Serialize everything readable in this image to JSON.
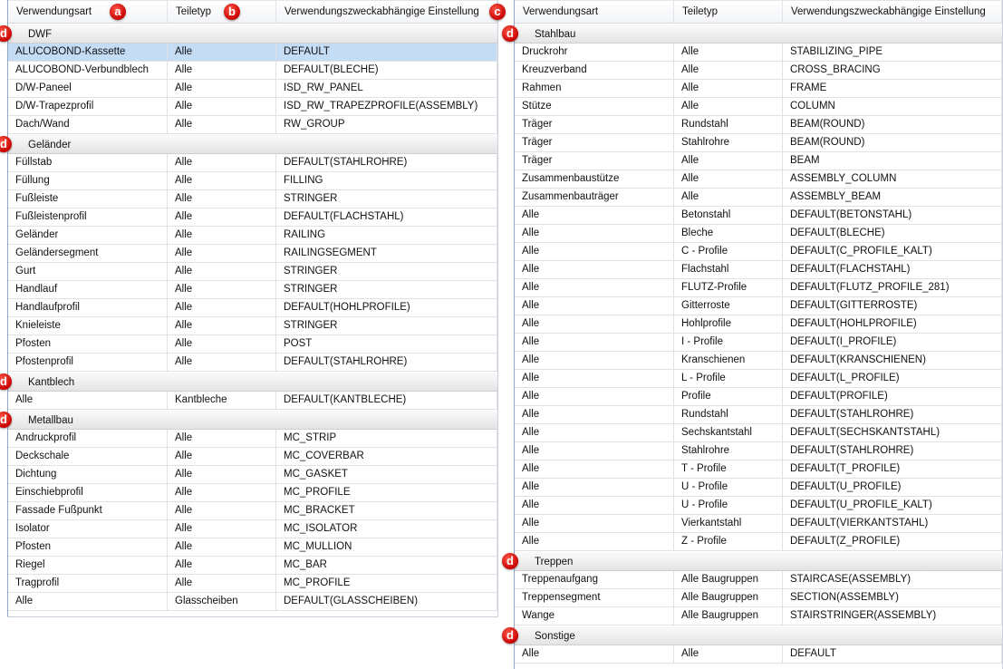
{
  "columns": [
    "Verwendungsart",
    "Teiletyp",
    "Verwendungszweckabhängige Einstellung"
  ],
  "markers": {
    "a": "a",
    "b": "b",
    "c": "c",
    "d": "d"
  },
  "left": [
    {
      "group": "DWF",
      "rows": [
        [
          "ALUCOBOND-Kassette",
          "Alle",
          "DEFAULT"
        ],
        [
          "ALUCOBOND-Verbundblech",
          "Alle",
          "DEFAULT(BLECHE)"
        ],
        [
          "D/W-Paneel",
          "Alle",
          "ISD_RW_PANEL"
        ],
        [
          "D/W-Trapezprofil",
          "Alle",
          "ISD_RW_TRAPEZPROFILE(ASSEMBLY)"
        ],
        [
          "Dach/Wand",
          "Alle",
          "RW_GROUP"
        ]
      ]
    },
    {
      "group": "Geländer",
      "rows": [
        [
          "Füllstab",
          "Alle",
          "DEFAULT(STAHLROHRE)"
        ],
        [
          "Füllung",
          "Alle",
          "FILLING"
        ],
        [
          "Fußleiste",
          "Alle",
          "STRINGER"
        ],
        [
          "Fußleistenprofil",
          "Alle",
          "DEFAULT(FLACHSTAHL)"
        ],
        [
          "Geländer",
          "Alle",
          "RAILING"
        ],
        [
          "Geländersegment",
          "Alle",
          "RAILINGSEGMENT"
        ],
        [
          "Gurt",
          "Alle",
          "STRINGER"
        ],
        [
          "Handlauf",
          "Alle",
          "STRINGER"
        ],
        [
          "Handlaufprofil",
          "Alle",
          "DEFAULT(HOHLPROFILE)"
        ],
        [
          "Knieleiste",
          "Alle",
          "STRINGER"
        ],
        [
          "Pfosten",
          "Alle",
          "POST"
        ],
        [
          "Pfostenprofil",
          "Alle",
          "DEFAULT(STAHLROHRE)"
        ]
      ]
    },
    {
      "group": "Kantblech",
      "rows": [
        [
          "Alle",
          "Kantbleche",
          "DEFAULT(KANTBLECHE)"
        ]
      ]
    },
    {
      "group": "Metallbau",
      "rows": [
        [
          "Andruckprofil",
          "Alle",
          "MC_STRIP"
        ],
        [
          "Deckschale",
          "Alle",
          "MC_COVERBAR"
        ],
        [
          "Dichtung",
          "Alle",
          "MC_GASKET"
        ],
        [
          "Einschiebprofil",
          "Alle",
          "MC_PROFILE"
        ],
        [
          "Fassade Fußpunkt",
          "Alle",
          "MC_BRACKET"
        ],
        [
          "Isolator",
          "Alle",
          "MC_ISOLATOR"
        ],
        [
          "Pfosten",
          "Alle",
          "MC_MULLION"
        ],
        [
          "Riegel",
          "Alle",
          "MC_BAR"
        ],
        [
          "Tragprofil",
          "Alle",
          "MC_PROFILE"
        ],
        [
          "Alle",
          "Glasscheiben",
          "DEFAULT(GLASSCHEIBEN)"
        ]
      ]
    }
  ],
  "right": [
    {
      "group": "Stahlbau",
      "rows": [
        [
          "Druckrohr",
          "Alle",
          "STABILIZING_PIPE"
        ],
        [
          "Kreuzverband",
          "Alle",
          "CROSS_BRACING"
        ],
        [
          "Rahmen",
          "Alle",
          "FRAME"
        ],
        [
          "Stütze",
          "Alle",
          "COLUMN"
        ],
        [
          "Träger",
          "Rundstahl",
          "BEAM(ROUND)"
        ],
        [
          "Träger",
          "Stahlrohre",
          "BEAM(ROUND)"
        ],
        [
          "Träger",
          "Alle",
          "BEAM"
        ],
        [
          "Zusammenbaustütze",
          "Alle",
          "ASSEMBLY_COLUMN"
        ],
        [
          "Zusammenbauträger",
          "Alle",
          "ASSEMBLY_BEAM"
        ],
        [
          "Alle",
          "Betonstahl",
          "DEFAULT(BETONSTAHL)"
        ],
        [
          "Alle",
          "Bleche",
          "DEFAULT(BLECHE)"
        ],
        [
          "Alle",
          "C - Profile",
          "DEFAULT(C_PROFILE_KALT)"
        ],
        [
          "Alle",
          "Flachstahl",
          "DEFAULT(FLACHSTAHL)"
        ],
        [
          "Alle",
          "FLUTZ-Profile",
          "DEFAULT(FLUTZ_PROFILE_281)"
        ],
        [
          "Alle",
          "Gitterroste",
          "DEFAULT(GITTERROSTE)"
        ],
        [
          "Alle",
          "Hohlprofile",
          "DEFAULT(HOHLPROFILE)"
        ],
        [
          "Alle",
          "I - Profile",
          "DEFAULT(I_PROFILE)"
        ],
        [
          "Alle",
          "Kranschienen",
          "DEFAULT(KRANSCHIENEN)"
        ],
        [
          "Alle",
          "L - Profile",
          "DEFAULT(L_PROFILE)"
        ],
        [
          "Alle",
          "Profile",
          "DEFAULT(PROFILE)"
        ],
        [
          "Alle",
          "Rundstahl",
          "DEFAULT(STAHLROHRE)"
        ],
        [
          "Alle",
          "Sechskantstahl",
          "DEFAULT(SECHSKANTSTAHL)"
        ],
        [
          "Alle",
          "Stahlrohre",
          "DEFAULT(STAHLROHRE)"
        ],
        [
          "Alle",
          "T - Profile",
          "DEFAULT(T_PROFILE)"
        ],
        [
          "Alle",
          "U - Profile",
          "DEFAULT(U_PROFILE)"
        ],
        [
          "Alle",
          "U - Profile",
          "DEFAULT(U_PROFILE_KALT)"
        ],
        [
          "Alle",
          "Vierkantstahl",
          "DEFAULT(VIERKANTSTAHL)"
        ],
        [
          "Alle",
          "Z - Profile",
          "DEFAULT(Z_PROFILE)"
        ]
      ]
    },
    {
      "group": "Treppen",
      "rows": [
        [
          "Treppenaufgang",
          "Alle Baugruppen",
          "STAIRCASE(ASSEMBLY)"
        ],
        [
          "Treppensegment",
          "Alle Baugruppen",
          "SECTION(ASSEMBLY)"
        ],
        [
          "Wange",
          "Alle Baugruppen",
          "STAIRSTRINGER(ASSEMBLY)"
        ]
      ]
    },
    {
      "group": "Sonstige",
      "rows": [
        [
          "Alle",
          "Alle",
          "DEFAULT"
        ]
      ]
    }
  ],
  "selected_row": "ALUCOBOND-Kassette"
}
